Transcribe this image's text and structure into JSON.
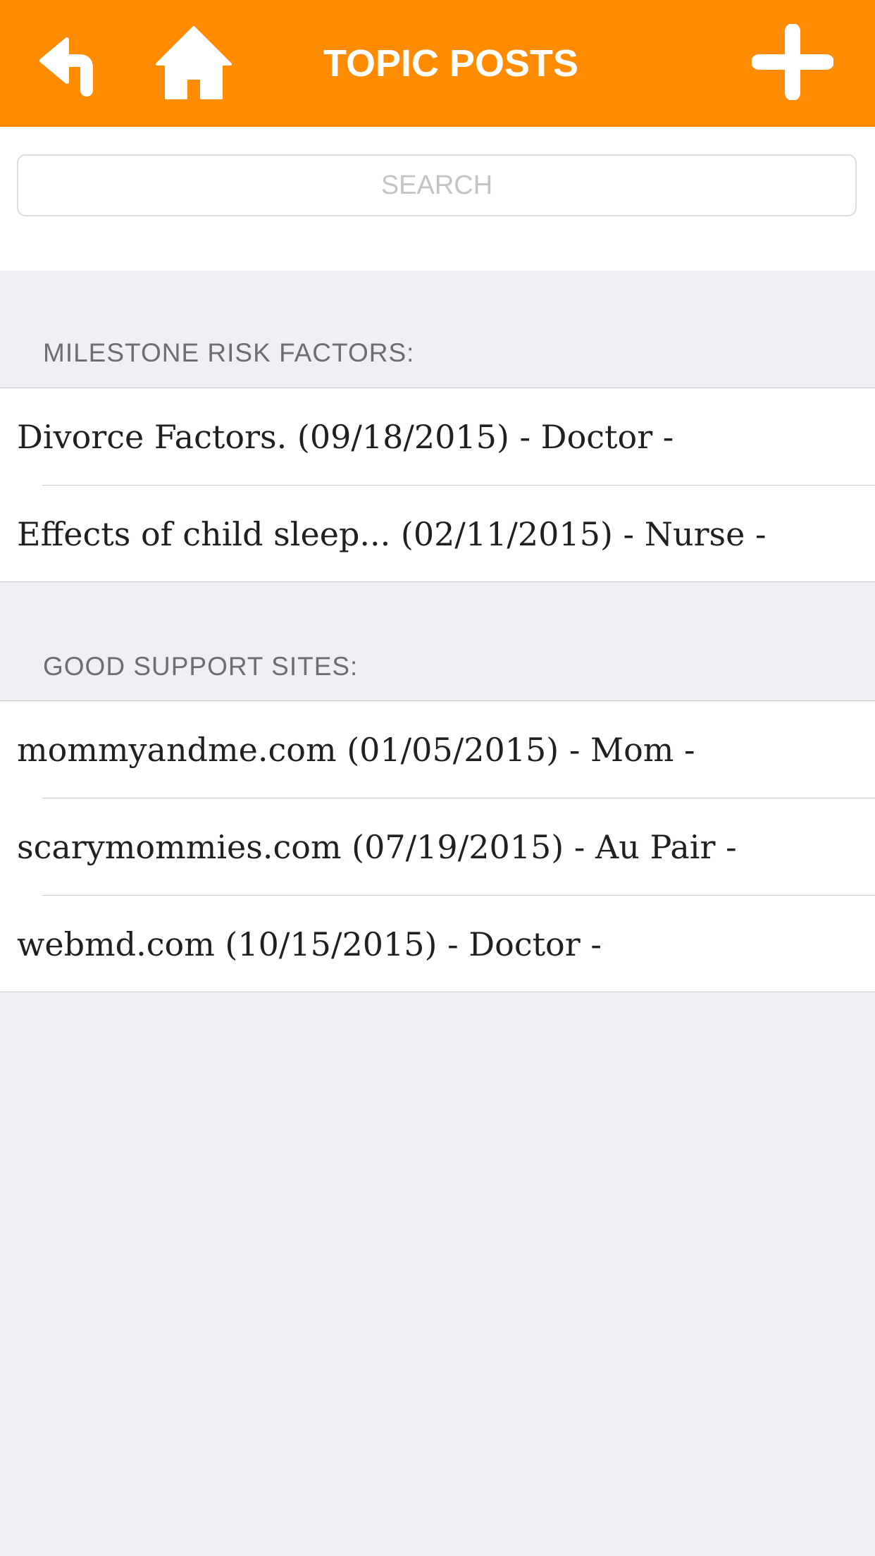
{
  "nav": {
    "title": "TOPIC POSTS",
    "back_icon": "back-arrow-icon",
    "home_icon": "home-icon",
    "add_icon": "plus-icon",
    "bar_color": "#ff8c00"
  },
  "search": {
    "placeholder": "SEARCH",
    "value": ""
  },
  "sections": [
    {
      "header": "MILESTONE RISK FACTORS:",
      "rows": [
        {
          "label": "Divorce Factors. (09/18/2015) - Doctor -"
        },
        {
          "label": "Effects of child sleep... (02/11/2015) - Nurse -"
        }
      ]
    },
    {
      "header": "GOOD SUPPORT SITES:",
      "rows": [
        {
          "label": "mommyandme.com (01/05/2015) - Mom -"
        },
        {
          "label": "scarymommies.com (07/19/2015) - Au Pair -"
        },
        {
          "label": "webmd.com (10/15/2015) - Doctor -"
        }
      ]
    }
  ]
}
